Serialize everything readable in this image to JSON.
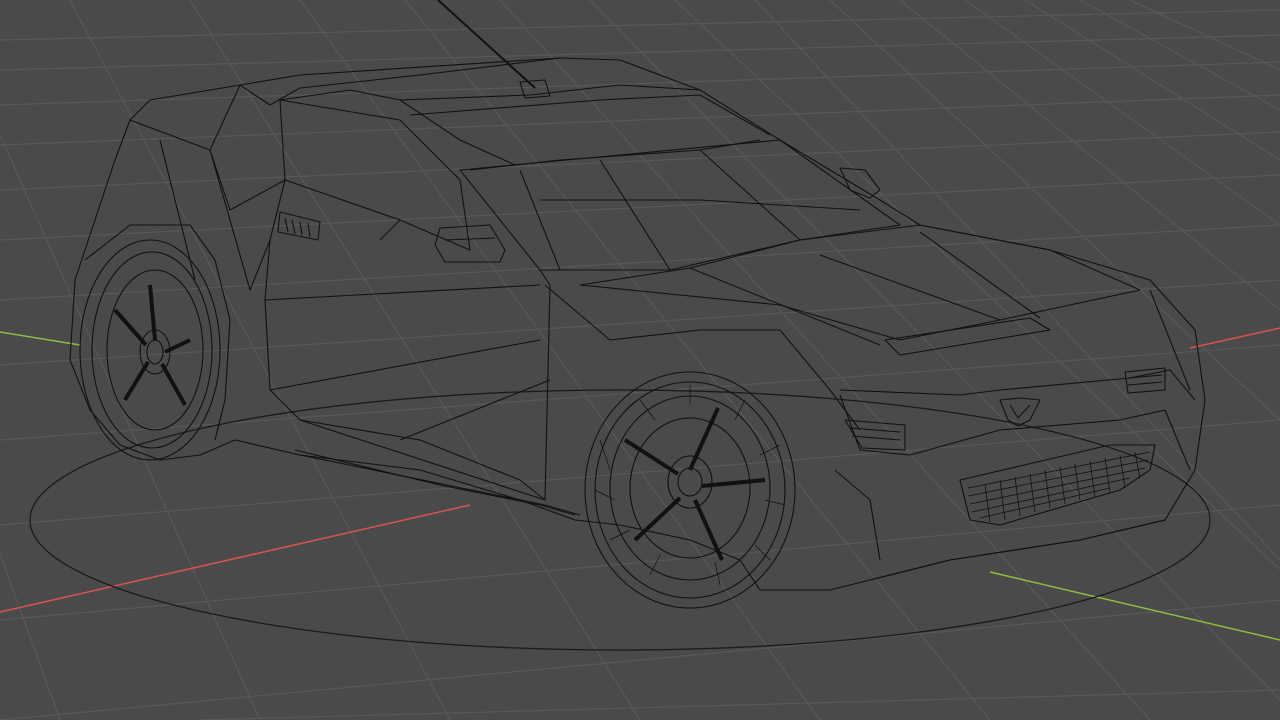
{
  "viewport": {
    "mode": "wireframe",
    "background_color": "#4a4a4a",
    "grid_color": "#5a5a5a",
    "x_axis_color": "#d9534f",
    "y_axis_color": "#8fbc3f",
    "wire_color": "#111111"
  },
  "scene": {
    "object": "car-wireframe-model",
    "has_empty_circle": true,
    "has_antenna": true
  }
}
